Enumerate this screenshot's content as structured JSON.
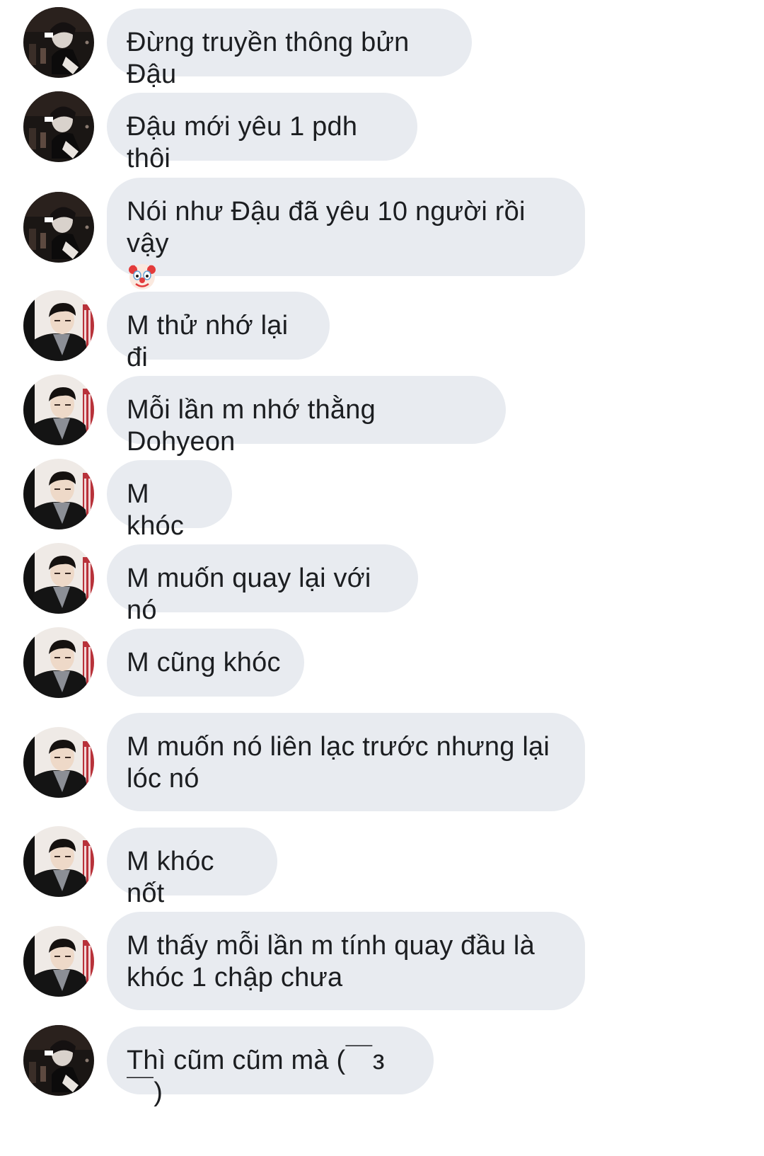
{
  "conversation": {
    "avatar_styles": {
      "a": "dark-photo-avatar",
      "b": "boy-photo-avatar"
    },
    "messages": [
      {
        "avatar": "a",
        "text": "Đừng truyền thông bửn Đậu"
      },
      {
        "avatar": "a",
        "text": "Đậu mới yêu 1 pdh thôi"
      },
      {
        "avatar": "a",
        "text": "Nói như Đậu đã yêu 10 người rồi vậy",
        "emoji": "clown-face-emoji"
      },
      {
        "avatar": "b",
        "text": "M thử nhớ lại đi"
      },
      {
        "avatar": "b",
        "text": "Mỗi lần m nhớ thằng Dohyeon"
      },
      {
        "avatar": "b",
        "text": "M khóc"
      },
      {
        "avatar": "b",
        "text": "M muốn quay lại với nó"
      },
      {
        "avatar": "b",
        "text": "M cũng khóc"
      },
      {
        "avatar": "b",
        "text": "M muốn nó liên lạc trước nhưng lại lóc nó"
      },
      {
        "avatar": "b",
        "text": "M khóc nốt"
      },
      {
        "avatar": "b",
        "text": "M thấy mỗi lần m tính quay đầu là khóc 1 chập chưa"
      },
      {
        "avatar": "a",
        "text": "Thì cũm cũm mà (￣з￣)"
      }
    ]
  },
  "colors": {
    "bubble_bg": "#e8ebf0",
    "text": "#1c1e21",
    "page_bg": "#ffffff"
  }
}
